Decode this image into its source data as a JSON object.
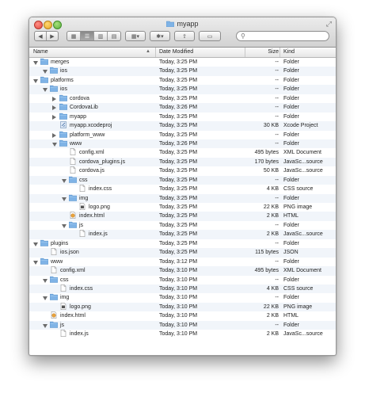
{
  "window": {
    "title": "myapp"
  },
  "toolbar": {
    "search_placeholder": ""
  },
  "columns": {
    "name": "Name",
    "date": "Date Modified",
    "size": "Size",
    "kind": "Kind"
  },
  "rows": [
    {
      "name": "merges",
      "date": "Today, 3:25 PM",
      "size": "--",
      "kind": "Folder",
      "depth": 0,
      "icon": "folder-icon",
      "disclosure": "open"
    },
    {
      "name": "ios",
      "date": "Today, 3:25 PM",
      "size": "--",
      "kind": "Folder",
      "depth": 1,
      "icon": "folder-icon",
      "disclosure": "open"
    },
    {
      "name": "platforms",
      "date": "Today, 3:25 PM",
      "size": "--",
      "kind": "Folder",
      "depth": 0,
      "icon": "folder-icon",
      "disclosure": "open"
    },
    {
      "name": "ios",
      "date": "Today, 3:25 PM",
      "size": "--",
      "kind": "Folder",
      "depth": 1,
      "icon": "folder-icon",
      "disclosure": "open"
    },
    {
      "name": "cordova",
      "date": "Today, 3:25 PM",
      "size": "--",
      "kind": "Folder",
      "depth": 2,
      "icon": "folder-icon",
      "disclosure": "closed"
    },
    {
      "name": "CordovaLib",
      "date": "Today, 3:26 PM",
      "size": "--",
      "kind": "Folder",
      "depth": 2,
      "icon": "folder-icon",
      "disclosure": "closed"
    },
    {
      "name": "myapp",
      "date": "Today, 3:25 PM",
      "size": "--",
      "kind": "Folder",
      "depth": 2,
      "icon": "folder-icon",
      "disclosure": "closed"
    },
    {
      "name": "myapp.xcodeproj",
      "date": "Today, 3:25 PM",
      "size": "30 KB",
      "kind": "Xcode Project",
      "depth": 2,
      "icon": "xcodeproj-icon",
      "disclosure": "none"
    },
    {
      "name": "platform_www",
      "date": "Today, 3:25 PM",
      "size": "--",
      "kind": "Folder",
      "depth": 2,
      "icon": "folder-icon",
      "disclosure": "closed"
    },
    {
      "name": "www",
      "date": "Today, 3:26 PM",
      "size": "--",
      "kind": "Folder",
      "depth": 2,
      "icon": "folder-icon",
      "disclosure": "open"
    },
    {
      "name": "config.xml",
      "date": "Today, 3:25 PM",
      "size": "495 bytes",
      "kind": "XML Document",
      "depth": 3,
      "icon": "file-icon",
      "disclosure": "none"
    },
    {
      "name": "cordova_plugins.js",
      "date": "Today, 3:25 PM",
      "size": "170 bytes",
      "kind": "JavaSc...source",
      "depth": 3,
      "icon": "file-icon",
      "disclosure": "none"
    },
    {
      "name": "cordova.js",
      "date": "Today, 3:25 PM",
      "size": "50 KB",
      "kind": "JavaSc...source",
      "depth": 3,
      "icon": "file-icon",
      "disclosure": "none"
    },
    {
      "name": "css",
      "date": "Today, 3:25 PM",
      "size": "--",
      "kind": "Folder",
      "depth": 3,
      "icon": "folder-icon",
      "disclosure": "open"
    },
    {
      "name": "index.css",
      "date": "Today, 3:25 PM",
      "size": "4 KB",
      "kind": "CSS source",
      "depth": 4,
      "icon": "file-icon",
      "disclosure": "none"
    },
    {
      "name": "img",
      "date": "Today, 3:25 PM",
      "size": "--",
      "kind": "Folder",
      "depth": 3,
      "icon": "folder-icon",
      "disclosure": "open"
    },
    {
      "name": "logo.png",
      "date": "Today, 3:25 PM",
      "size": "22 KB",
      "kind": "PNG image",
      "depth": 4,
      "icon": "image-icon",
      "disclosure": "none"
    },
    {
      "name": "index.html",
      "date": "Today, 3:25 PM",
      "size": "2 KB",
      "kind": "HTML",
      "depth": 3,
      "icon": "html-icon",
      "disclosure": "none"
    },
    {
      "name": "js",
      "date": "Today, 3:25 PM",
      "size": "--",
      "kind": "Folder",
      "depth": 3,
      "icon": "folder-icon",
      "disclosure": "open"
    },
    {
      "name": "index.js",
      "date": "Today, 3:25 PM",
      "size": "2 KB",
      "kind": "JavaSc...source",
      "depth": 4,
      "icon": "file-icon",
      "disclosure": "none"
    },
    {
      "name": "plugins",
      "date": "Today, 3:25 PM",
      "size": "--",
      "kind": "Folder",
      "depth": 0,
      "icon": "folder-icon",
      "disclosure": "open"
    },
    {
      "name": "ios.json",
      "date": "Today, 3:25 PM",
      "size": "115 bytes",
      "kind": "JSON",
      "depth": 1,
      "icon": "file-icon",
      "disclosure": "none"
    },
    {
      "name": "www",
      "date": "Today, 3:12 PM",
      "size": "--",
      "kind": "Folder",
      "depth": 0,
      "icon": "folder-icon",
      "disclosure": "open"
    },
    {
      "name": "config.xml",
      "date": "Today, 3:10 PM",
      "size": "495 bytes",
      "kind": "XML Document",
      "depth": 1,
      "icon": "file-icon",
      "disclosure": "none"
    },
    {
      "name": "css",
      "date": "Today, 3:10 PM",
      "size": "--",
      "kind": "Folder",
      "depth": 1,
      "icon": "folder-icon",
      "disclosure": "open"
    },
    {
      "name": "index.css",
      "date": "Today, 3:10 PM",
      "size": "4 KB",
      "kind": "CSS source",
      "depth": 2,
      "icon": "file-icon",
      "disclosure": "none"
    },
    {
      "name": "img",
      "date": "Today, 3:10 PM",
      "size": "--",
      "kind": "Folder",
      "depth": 1,
      "icon": "folder-icon",
      "disclosure": "open"
    },
    {
      "name": "logo.png",
      "date": "Today, 3:10 PM",
      "size": "22 KB",
      "kind": "PNG image",
      "depth": 2,
      "icon": "image-icon",
      "disclosure": "none"
    },
    {
      "name": "index.html",
      "date": "Today, 3:10 PM",
      "size": "2 KB",
      "kind": "HTML",
      "depth": 1,
      "icon": "html-icon",
      "disclosure": "none"
    },
    {
      "name": "js",
      "date": "Today, 3:10 PM",
      "size": "--",
      "kind": "Folder",
      "depth": 1,
      "icon": "folder-icon",
      "disclosure": "open"
    },
    {
      "name": "index.js",
      "date": "Today, 3:10 PM",
      "size": "2 KB",
      "kind": "JavaSc...source",
      "depth": 2,
      "icon": "file-icon",
      "disclosure": "none"
    }
  ],
  "colors": {
    "folder": "#7fb3e6",
    "folder_dark": "#5b93cc",
    "alt_row": "#f1f5fa"
  }
}
